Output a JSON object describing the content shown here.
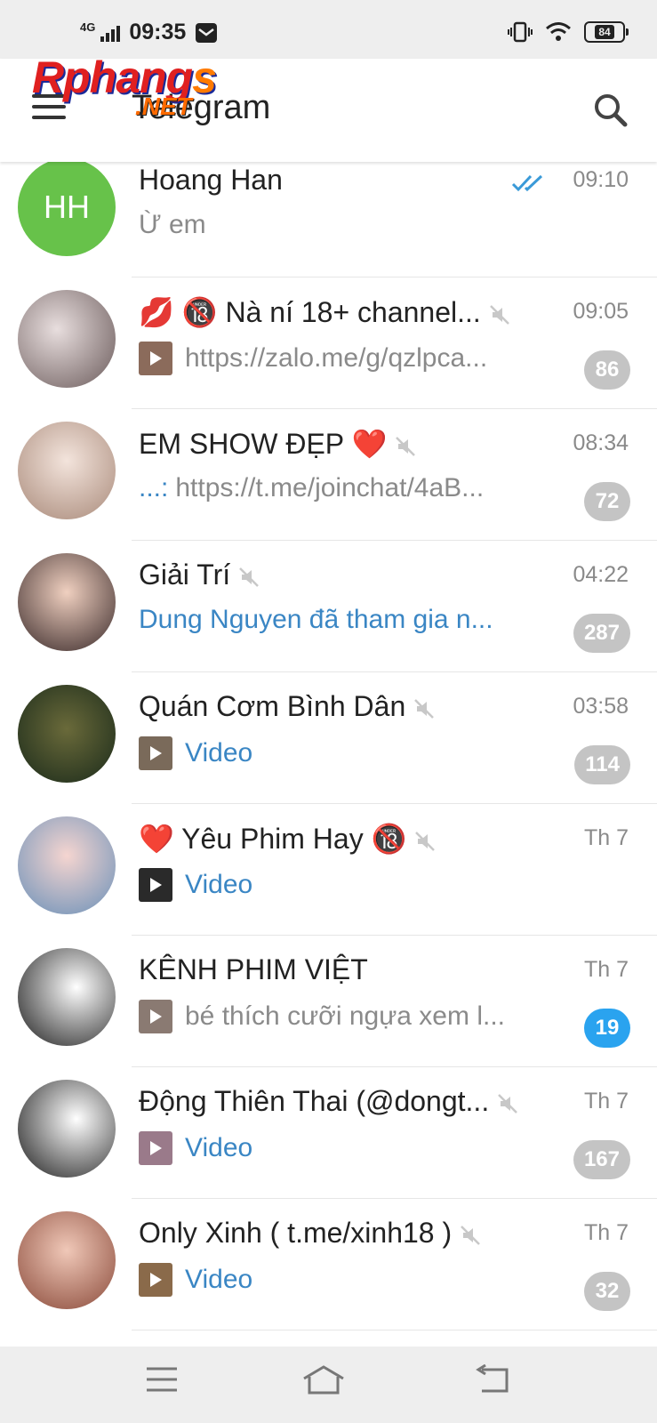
{
  "status_bar": {
    "network": "4G",
    "time": "09:35",
    "battery": "84"
  },
  "watermark": {
    "main": "Rphang",
    "s": "s",
    "sub": ".NET"
  },
  "header": {
    "title": "Telegram"
  },
  "chats": [
    {
      "name": "Hoang Han",
      "time": "09:10",
      "preview": "Ừ em",
      "initials": "HH",
      "avatar_color": "#67c24a",
      "muted": false,
      "read": true,
      "badge": ""
    },
    {
      "name": "💋 🔞 Nà ní 18+ channel...",
      "time": "09:05",
      "preview": "https://zalo.me/g/qzlpca...",
      "muted": true,
      "badge": "86",
      "thumb": true
    },
    {
      "name": "EM SHOW ĐẸP ❤️",
      "time": "08:34",
      "sender": "...:",
      "preview": "https://t.me/joinchat/4aB...",
      "muted": true,
      "badge": "72"
    },
    {
      "name": "Giải Trí",
      "time": "04:22",
      "preview": "Dung Nguyen đã tham gia n...",
      "preview_blue": true,
      "muted": true,
      "badge": "287"
    },
    {
      "name": "Quán Cơm Bình Dân",
      "time": "03:58",
      "preview": "Video",
      "preview_blue": true,
      "muted": true,
      "badge": "114",
      "thumb": true
    },
    {
      "name": "❤️ Yêu Phim Hay 🔞",
      "time": "Th 7",
      "preview": "Video",
      "preview_blue": true,
      "muted": true,
      "badge": "",
      "thumb": true
    },
    {
      "name": "KÊNH PHIM VIỆT",
      "time": "Th 7",
      "preview": "bé thích cưỡi ngựa   xem l...",
      "muted": false,
      "badge": "19",
      "badge_active": true,
      "thumb": true
    },
    {
      "name": "Động Thiên Thai (@dongt...",
      "time": "Th 7",
      "preview": "Video",
      "preview_blue": true,
      "muted": true,
      "badge": "167",
      "thumb": true
    },
    {
      "name": "Only Xinh ( t.me/xinh18 )",
      "time": "Th 7",
      "preview": "Video",
      "preview_blue": true,
      "muted": true,
      "badge": "32",
      "thumb": true
    }
  ],
  "colors": {
    "accent": "#2aa3ef",
    "link": "#3a86c4",
    "badge_muted": "#c4c4c4"
  }
}
